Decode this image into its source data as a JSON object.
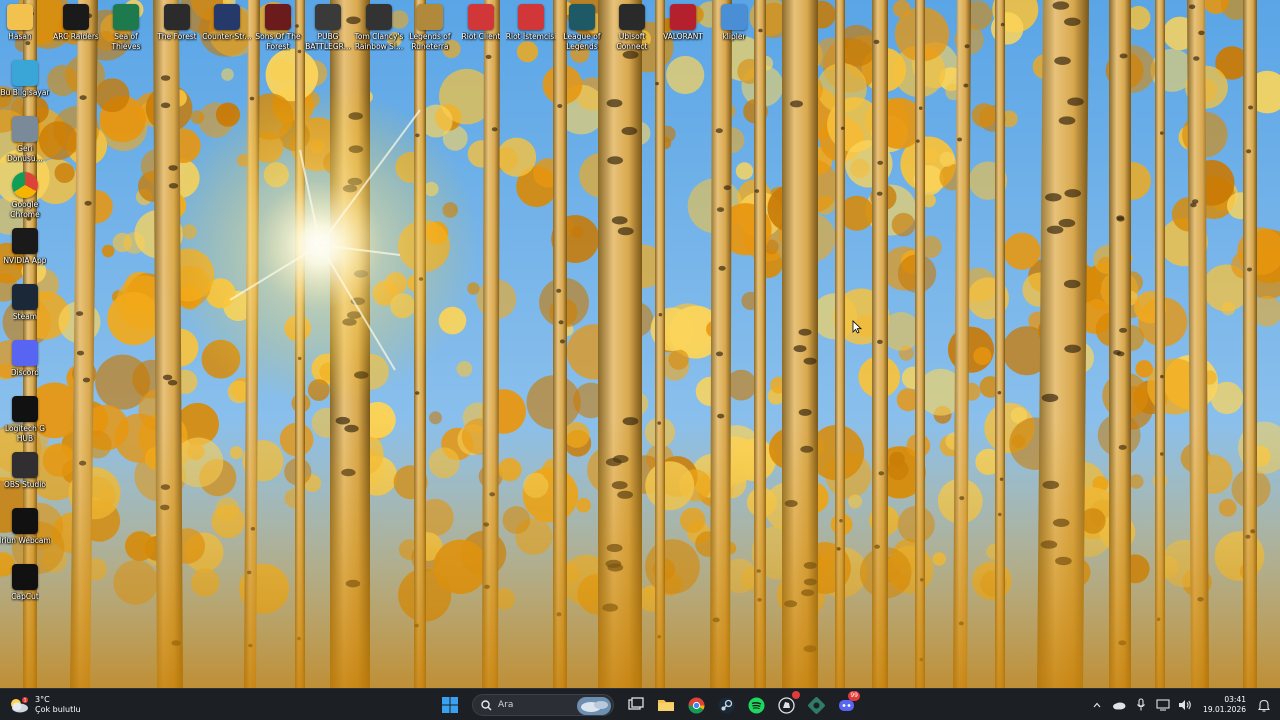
{
  "desktop": {
    "top_row": [
      {
        "id": "hasan",
        "label": "Hasan",
        "icon": "folder-icon",
        "color": "#f2c14e"
      },
      {
        "id": "arc-raiders",
        "label": "ARC Raiders",
        "icon": "arc-raiders-icon",
        "color": "#1a1a1a"
      },
      {
        "id": "sea-of-thieves",
        "label": "Sea of Thieves",
        "icon": "sea-of-thieves-icon",
        "color": "#1d7a4d"
      },
      {
        "id": "the-forest",
        "label": "The Forest",
        "icon": "the-forest-icon",
        "color": "#2b2b2b"
      },
      {
        "id": "counter-strike",
        "label": "Counter-Str...",
        "icon": "counter-strike-icon",
        "color": "#253a6b"
      },
      {
        "id": "sons-of-the-forest",
        "label": "Sons Of The Forest",
        "icon": "sons-of-the-forest-icon",
        "color": "#6b1b1b"
      },
      {
        "id": "pubg",
        "label": "PUBG BATTLEGR...",
        "icon": "pubg-icon",
        "color": "#3a3a3a"
      },
      {
        "id": "rainbow-six",
        "label": "Tom Clancy's Rainbow Si...",
        "icon": "rainbow-six-icon",
        "color": "#333333"
      },
      {
        "id": "legends-of-runeterra",
        "label": "Legends of Runeterra",
        "icon": "runeterra-icon",
        "color": "#b08a3a"
      },
      {
        "id": "riot-client",
        "label": "Riot Client",
        "icon": "riot-client-icon",
        "color": "#d13639"
      },
      {
        "id": "riot-istemcisi",
        "label": "Riot İstemcisi",
        "icon": "riot-client-icon",
        "color": "#d13639"
      },
      {
        "id": "league-of-legends",
        "label": "League of Legends",
        "icon": "league-of-legends-icon",
        "color": "#1e5a66"
      },
      {
        "id": "ubisoft-connect",
        "label": "Ubisoft Connect",
        "icon": "ubisoft-connect-icon",
        "color": "#2a2a2a"
      },
      {
        "id": "valorant",
        "label": "VALORANT",
        "icon": "valorant-icon",
        "color": "#b4202e"
      },
      {
        "id": "klipler",
        "label": "klipler",
        "icon": "folder-icon",
        "color": "#4a8fd6"
      }
    ],
    "left_column": [
      {
        "id": "bu-bilgisayar",
        "label": "Bu Bilgisayar",
        "icon": "computer-icon",
        "color": "#3aa6d8"
      },
      {
        "id": "geri-donusum",
        "label": "Geri Dönüşü...",
        "icon": "recycle-bin-icon",
        "color": "#7a8a99"
      },
      {
        "id": "google-chrome",
        "label": "Google Chrome",
        "icon": "chrome-icon",
        "color": "#ffffff"
      },
      {
        "id": "nvidia-app",
        "label": "NVIDIA App",
        "icon": "nvidia-icon",
        "color": "#1a1a1a"
      },
      {
        "id": "steam",
        "label": "Steam",
        "icon": "steam-icon",
        "color": "#1b2838"
      },
      {
        "id": "discord",
        "label": "Discord",
        "icon": "discord-icon",
        "color": "#5865f2"
      },
      {
        "id": "logitech-g-hub",
        "label": "Logitech G HUB",
        "icon": "logitech-icon",
        "color": "#111111"
      },
      {
        "id": "obs-studio",
        "label": "OBS Studio",
        "icon": "obs-icon",
        "color": "#302e31"
      },
      {
        "id": "iriun-webcam",
        "label": "Iriun Webcam",
        "icon": "webcam-icon",
        "color": "#111111"
      },
      {
        "id": "capcut",
        "label": "CapCut",
        "icon": "capcut-icon",
        "color": "#111111"
      }
    ]
  },
  "taskbar": {
    "weather": {
      "temp": "3°C",
      "condition": "Çok bulutlu",
      "icon": "cloudy-icon"
    },
    "search_placeholder": "Ara",
    "pinned": [
      {
        "id": "start",
        "icon": "windows-start-icon"
      },
      {
        "id": "task-view",
        "icon": "task-view-icon"
      },
      {
        "id": "file-explorer",
        "icon": "file-explorer-icon"
      },
      {
        "id": "chrome",
        "icon": "chrome-icon"
      },
      {
        "id": "steam",
        "icon": "steam-icon"
      },
      {
        "id": "spotify",
        "icon": "spotify-icon"
      },
      {
        "id": "riot",
        "icon": "riot-client-icon",
        "badge": ""
      },
      {
        "id": "app-gear",
        "icon": "settings-app-icon"
      },
      {
        "id": "discord",
        "icon": "discord-icon",
        "badge": "99"
      }
    ],
    "tray": {
      "time": "03:41",
      "date": "19.01.2026"
    }
  }
}
